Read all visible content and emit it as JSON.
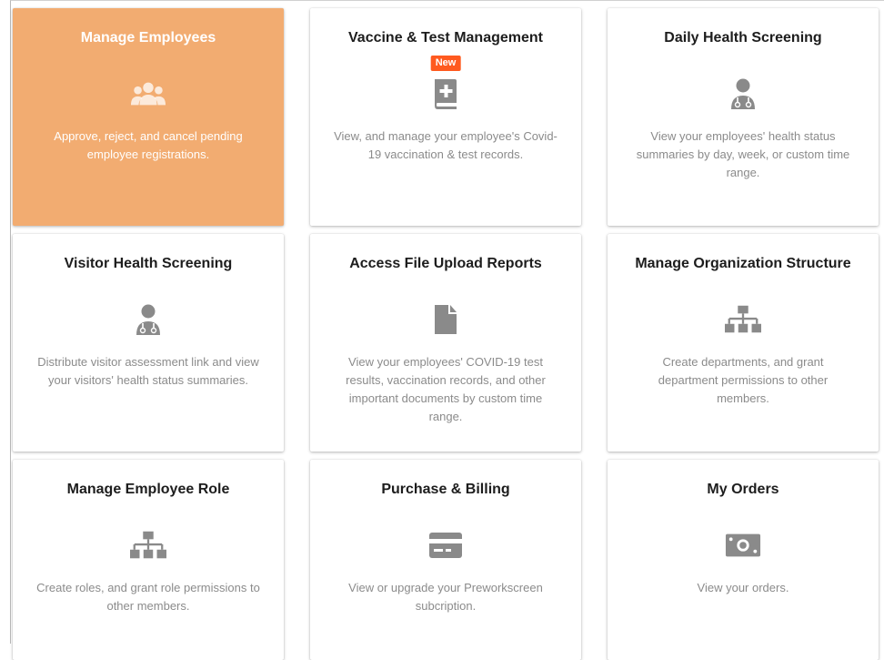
{
  "cards": [
    {
      "title": "Manage Employees",
      "icon": "users-icon",
      "description": "Approve, reject, and cancel pending employee registrations."
    },
    {
      "title": "Vaccine & Test Management",
      "badge": "New",
      "icon": "medical-book-icon",
      "description": "View, and manage your employee's Covid-19 vaccination & test records."
    },
    {
      "title": "Daily Health Screening",
      "icon": "doctor-icon",
      "description": "View your employees' health status summaries by day, week, or custom time range."
    },
    {
      "title": "Visitor Health Screening",
      "icon": "doctor-icon",
      "description": "Distribute visitor assessment link and view your visitors' health status summaries."
    },
    {
      "title": "Access File Upload Reports",
      "icon": "file-icon",
      "description": "View your employees' COVID-19 test results, vaccination records, and other important documents by custom time range."
    },
    {
      "title": "Manage Organization Structure",
      "icon": "org-chart-icon",
      "description": "Create departments, and grant department permissions to other members."
    },
    {
      "title": "Manage Employee Role",
      "icon": "org-chart-icon",
      "description": "Create roles, and grant role permissions to other members."
    },
    {
      "title": "Purchase & Billing",
      "icon": "credit-card-icon",
      "description": "View or upgrade your Preworkscreen subcription."
    },
    {
      "title": "My Orders",
      "icon": "money-icon",
      "description": "View your orders."
    }
  ],
  "colors": {
    "active_card": "#f2ac71",
    "badge": "#ff5a1f",
    "icon": "#8a8a8a",
    "text_muted": "#8b8b8b"
  }
}
